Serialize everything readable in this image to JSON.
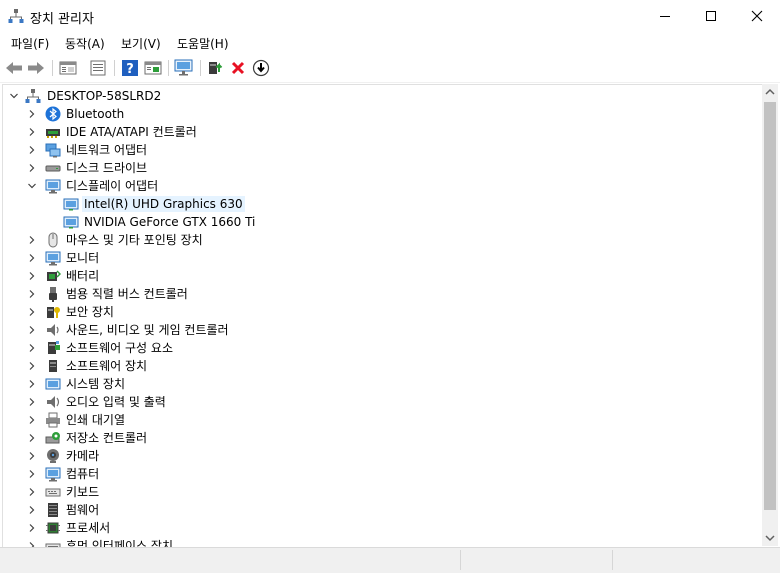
{
  "window": {
    "title": "장치 관리자",
    "controls": {
      "minimize_icon": "minimize-icon",
      "maximize_icon": "maximize-icon",
      "close_icon": "close-icon"
    }
  },
  "menu": {
    "items": [
      {
        "label": "파일(F)"
      },
      {
        "label": "동작(A)"
      },
      {
        "label": "보기(V)"
      },
      {
        "label": "도움말(H)"
      }
    ]
  },
  "toolbar": {
    "icons": [
      "back-icon",
      "forward-icon",
      "properties-icon",
      "device-list-icon",
      "help-icon",
      "resources-icon",
      "scan-monitor-icon",
      "update-driver-icon",
      "uninstall-icon",
      "disable-icon"
    ]
  },
  "tree": {
    "root": {
      "label": "DESKTOP-58SLRD2"
    },
    "categories": [
      {
        "label": "Bluetooth",
        "icon": "bluetooth-icon"
      },
      {
        "label": "IDE ATA/ATAPI 컨트롤러",
        "icon": "ide-controller-icon"
      },
      {
        "label": "네트워크 어댑터",
        "icon": "network-adapter-icon"
      },
      {
        "label": "디스크 드라이브",
        "icon": "disk-drive-icon"
      },
      {
        "label": "디스플레이 어댑터",
        "icon": "display-adapter-icon",
        "expanded": true,
        "children": [
          {
            "label": "Intel(R) UHD Graphics 630",
            "selected": true
          },
          {
            "label": "NVIDIA GeForce GTX 1660 Ti"
          }
        ]
      },
      {
        "label": "마우스 및 기타 포인팅 장치",
        "icon": "mouse-icon"
      },
      {
        "label": "모니터",
        "icon": "monitor-icon"
      },
      {
        "label": "배터리",
        "icon": "battery-icon"
      },
      {
        "label": "범용 직렬 버스 컨트롤러",
        "icon": "usb-controller-icon"
      },
      {
        "label": "보안 장치",
        "icon": "security-device-icon"
      },
      {
        "label": "사운드, 비디오 및 게임 컨트롤러",
        "icon": "sound-icon"
      },
      {
        "label": "소프트웨어 구성 요소",
        "icon": "software-component-icon"
      },
      {
        "label": "소프트웨어 장치",
        "icon": "software-device-icon"
      },
      {
        "label": "시스템 장치",
        "icon": "system-device-icon"
      },
      {
        "label": "오디오 입력 및 출력",
        "icon": "audio-io-icon"
      },
      {
        "label": "인쇄 대기열",
        "icon": "print-queue-icon"
      },
      {
        "label": "저장소 컨트롤러",
        "icon": "storage-controller-icon"
      },
      {
        "label": "카메라",
        "icon": "camera-icon"
      },
      {
        "label": "컴퓨터",
        "icon": "computer-icon"
      },
      {
        "label": "키보드",
        "icon": "keyboard-icon"
      },
      {
        "label": "펌웨어",
        "icon": "firmware-icon"
      },
      {
        "label": "프로세서",
        "icon": "processor-icon"
      },
      {
        "label": "휴먼 인터페이스 장치",
        "icon": "hid-icon"
      }
    ]
  },
  "colors": {
    "selection": "#e5f3ff",
    "close_x": "#e81123",
    "help_blue": "#1f5fbf",
    "green": "#2e9e3a"
  }
}
